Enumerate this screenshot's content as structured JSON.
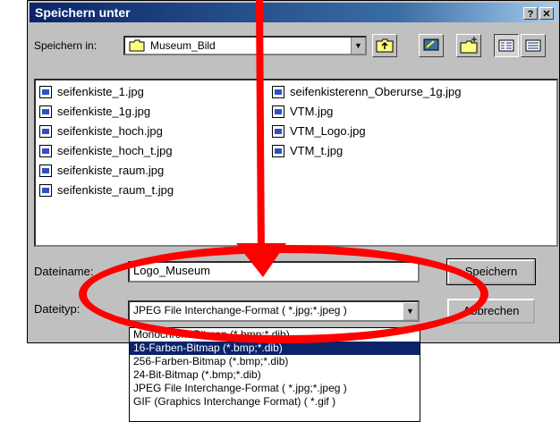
{
  "window": {
    "title": "Speichern unter",
    "help_btn": "?",
    "close_btn": "✕"
  },
  "lookin": {
    "label": "Speichern in:",
    "value": "Museum_Bild"
  },
  "files": {
    "col1": [
      "seifenkiste_1.jpg",
      "seifenkiste_1g.jpg",
      "seifenkiste_hoch.jpg",
      "seifenkiste_hoch_t.jpg",
      "seifenkiste_raum.jpg",
      "seifenkiste_raum_t.jpg"
    ],
    "col2": [
      "seifenkisterenn_Oberurse_1g.jpg",
      "VTM.jpg",
      "VTM_Logo.jpg",
      "VTM_t.jpg"
    ]
  },
  "filename": {
    "label": "Dateiname:",
    "value": "Logo_Museum"
  },
  "filetype": {
    "label": "Dateityp:",
    "value": "JPEG File Interchange-Format ( *.jpg;*.jpeg )"
  },
  "buttons": {
    "save": "Speichern",
    "cancel": "Abbrechen"
  },
  "dropdown_options": [
    "Monochrom-Bitmap (*.bmp;*.dib)",
    "16-Farben-Bitmap (*.bmp;*.dib)",
    "256-Farben-Bitmap (*.bmp;*.dib)",
    "24-Bit-Bitmap (*.bmp;*.dib)",
    "JPEG File Interchange-Format ( *.jpg;*.jpeg )",
    "GIF (Graphics Interchange Format) ( *.gif )"
  ],
  "dropdown_selected_index": 1,
  "colors": {
    "title_bar": "#0a246a",
    "highlight": "#0a246a",
    "annotation": "#ff0000"
  }
}
